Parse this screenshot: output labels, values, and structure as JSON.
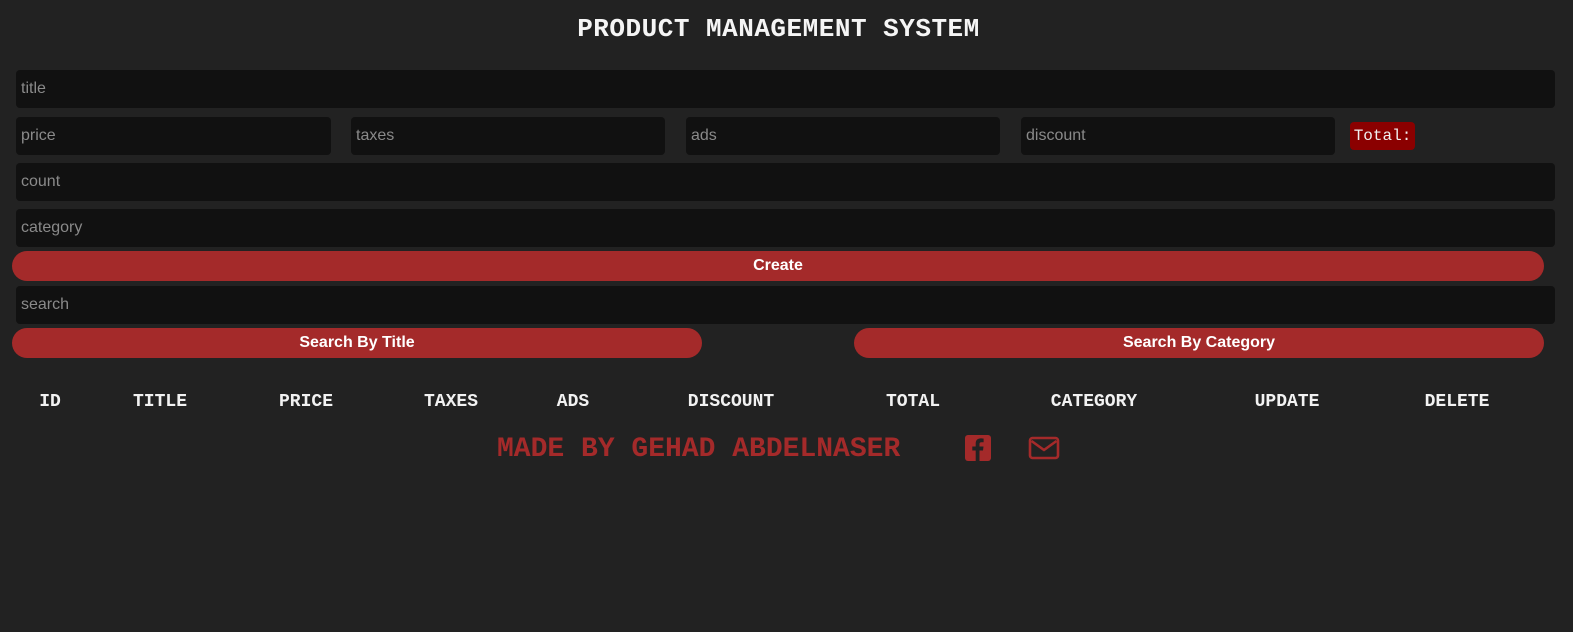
{
  "header": {
    "title": "PRODUCT MANAGEMENT SYSTEM"
  },
  "form": {
    "title_placeholder": "title",
    "price_placeholder": "price",
    "taxes_placeholder": "taxes",
    "ads_placeholder": "ads",
    "discount_placeholder": "discount",
    "total_label": "Total:",
    "count_placeholder": "count",
    "category_placeholder": "category",
    "create_label": "Create"
  },
  "search": {
    "placeholder": "search",
    "by_title_label": "Search By Title",
    "by_category_label": "Search By Category"
  },
  "table": {
    "headers": [
      "ID",
      "TITLE",
      "PRICE",
      "TAXES",
      "ADS",
      "DISCOUNT",
      "TOTAL",
      "CATEGORY",
      "UPDATE",
      "DELETE"
    ]
  },
  "footer": {
    "credit": "MADE BY GEHAD ABDELNASER",
    "icons": [
      "facebook-square-icon",
      "envelope-icon"
    ]
  },
  "colors": {
    "background": "#222222",
    "input_bg": "#111111",
    "accent": "#a42a2a",
    "total_badge": "#8b0000"
  }
}
